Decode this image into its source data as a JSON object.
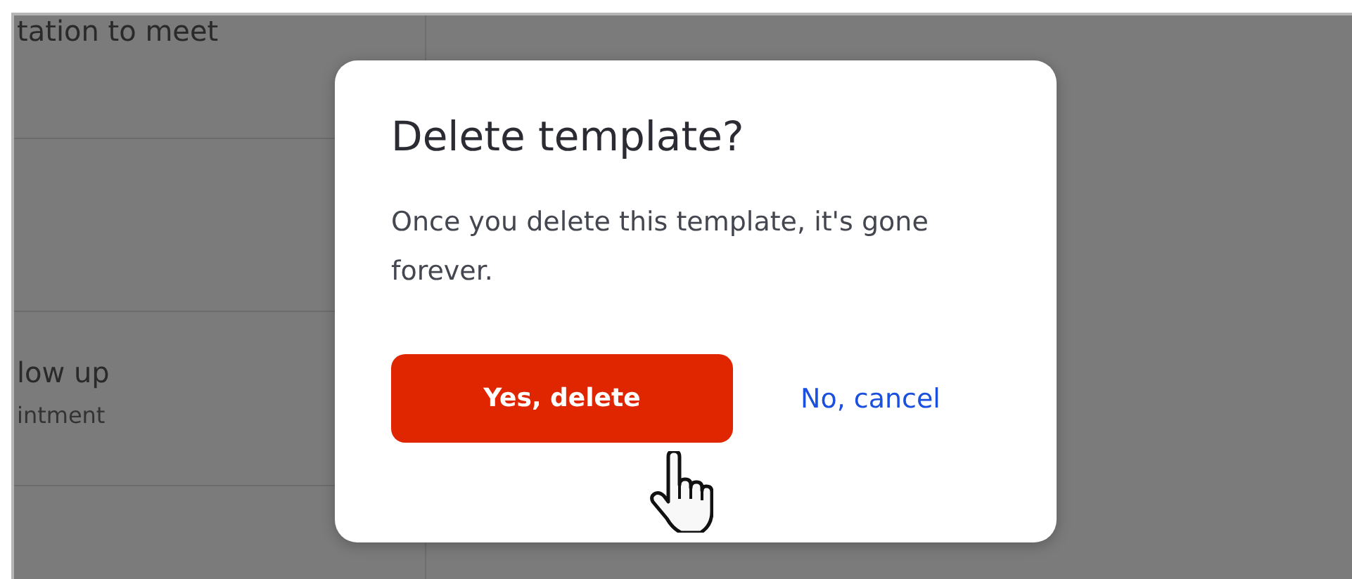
{
  "background_list": {
    "rows": [
      {
        "title": "tation to meet"
      },
      {
        "title": "low up",
        "subtitle": "intment"
      }
    ]
  },
  "dialog": {
    "title": "Delete template?",
    "message": "Once you delete this template, it's gone forever.",
    "confirm_button": "Yes, delete",
    "cancel_link": "No, cancel"
  }
}
